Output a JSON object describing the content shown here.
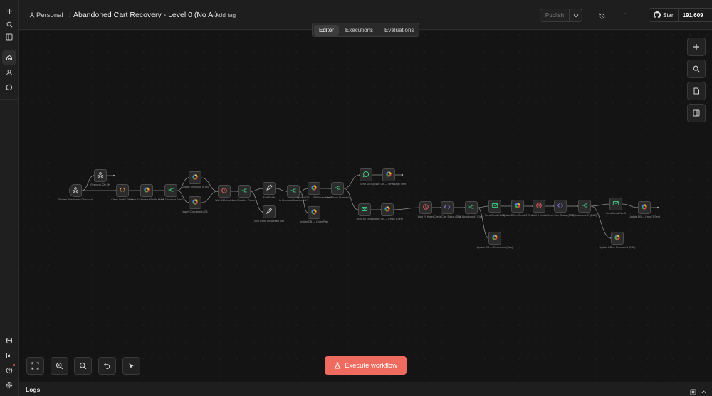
{
  "header": {
    "project": "Personal",
    "workflow_title": "Abandoned Cart Recovery - Level 0 (No AI)",
    "add_tag": "+ Add tag",
    "publish": "Publish",
    "star": "Star",
    "star_count": "191,609"
  },
  "tabs": [
    {
      "label": "Editor",
      "active": true
    },
    {
      "label": "Executions",
      "active": false
    },
    {
      "label": "Evaluations",
      "active": false
    }
  ],
  "execute_button": "Execute workflow",
  "logs_label": "Logs",
  "colors": {
    "execute": "#ef6b5f",
    "node_green": "#3cc47c",
    "node_orange": "#f0a23a",
    "node_red": "#e65b5b",
    "node_purple": "#8a7bf2"
  },
  "nodes": [
    {
      "id": "n1",
      "label": "Review Abandoned Checkout",
      "icon": "webhook-icon",
      "color": "#d6d6d6"
    },
    {
      "id": "n2",
      "label": "Respond 200 OK",
      "icon": "webhook-icon",
      "color": "#d6d6d6"
    },
    {
      "id": "n3",
      "label": "Clean Useful Fields",
      "icon": "code-icon",
      "color": "#f0a23a"
    },
    {
      "id": "n4",
      "label": "Check If Checkout Exists in DB",
      "icon": "db-icon",
      "color": "#ef6b5f"
    },
    {
      "id": "n5",
      "label": "Does Checkout Exist?",
      "icon": "if-icon",
      "color": "#3cc47c"
    },
    {
      "id": "n6",
      "label": "Update Checkout in DB",
      "icon": "db-icon",
      "color": "#ef6b5f"
    },
    {
      "id": "n7",
      "label": "Insert Checkout in DB",
      "icon": "db-icon",
      "color": "#ef6b5f"
    },
    {
      "id": "n8",
      "label": "Wait 15 Minutes",
      "icon": "wait-icon",
      "color": "#e65b5b"
    },
    {
      "id": "n9",
      "label": "Has Email or Phone?",
      "icon": "if-icon",
      "color": "#3cc47c"
    },
    {
      "id": "n10",
      "label": "Edit Fields",
      "icon": "edit-icon",
      "color": "#d6d6d6"
    },
    {
      "id": "n11",
      "label": "Stop Flow: No contact info",
      "icon": "stop-icon",
      "color": "#d6d6d6"
    },
    {
      "id": "n12",
      "label": "Is Checkout Abandoned?",
      "icon": "if-icon",
      "color": "#3cc47c"
    },
    {
      "id": "n13",
      "label": "Update DB — Still Abandoned",
      "icon": "db-icon",
      "color": "#ef6b5f"
    },
    {
      "id": "n14",
      "label": "Update DB — Order Paid",
      "icon": "db-icon",
      "color": "#ef6b5f"
    },
    {
      "id": "n15",
      "label": "Has Phone Number?",
      "icon": "if-icon",
      "color": "#3cc47c"
    },
    {
      "id": "n16",
      "label": "Send SMS",
      "icon": "sms-icon",
      "color": "#3cc47c"
    },
    {
      "id": "n17",
      "label": "Update DB — WhatsApp Sent",
      "icon": "db-icon",
      "color": "#ef6b5f"
    },
    {
      "id": "n18",
      "label": "Send an Email",
      "icon": "mail-icon",
      "color": "#3cc47c"
    },
    {
      "id": "n19",
      "label": "Update DB — Email 1 Sent",
      "icon": "db-icon",
      "color": "#ef6b5f"
    },
    {
      "id": "n20",
      "label": "Wait 24 Hours",
      "icon": "wait-icon",
      "color": "#e65b5b"
    },
    {
      "id": "n21",
      "label": "Check Cart Status (DB)",
      "icon": "code-icon",
      "color": "#8a7bf2"
    },
    {
      "id": "n22",
      "label": "Is Abandoned? (Day)",
      "icon": "if-icon",
      "color": "#3cc47c"
    },
    {
      "id": "n23",
      "label": "Send Email No. 2",
      "icon": "mail-icon",
      "color": "#3cc47c"
    },
    {
      "id": "n24",
      "label": "Update DB — Recovered (Day)",
      "icon": "db-icon",
      "color": "#ef6b5f"
    },
    {
      "id": "n25",
      "label": "Update DB — Email 2 Sent",
      "icon": "db-icon",
      "color": "#ef6b5f"
    },
    {
      "id": "n26",
      "label": "Wait 3 Hours",
      "icon": "wait-icon",
      "color": "#e65b5b"
    },
    {
      "id": "n27",
      "label": "Check Cart Status (DB2)",
      "icon": "code-icon",
      "color": "#8a7bf2"
    },
    {
      "id": "n28",
      "label": "Is Abandoned? (DB2)",
      "icon": "if-icon",
      "color": "#3cc47c"
    },
    {
      "id": "n29",
      "label": "Send Email No. 3",
      "icon": "mail-icon",
      "color": "#3cc47c"
    },
    {
      "id": "n30",
      "label": "Update DB — Recovered (DB2)",
      "icon": "db-icon",
      "color": "#ef6b5f"
    },
    {
      "id": "n31",
      "label": "Update DB — Email 3 Sent",
      "icon": "db-icon",
      "color": "#ef6b5f"
    }
  ]
}
